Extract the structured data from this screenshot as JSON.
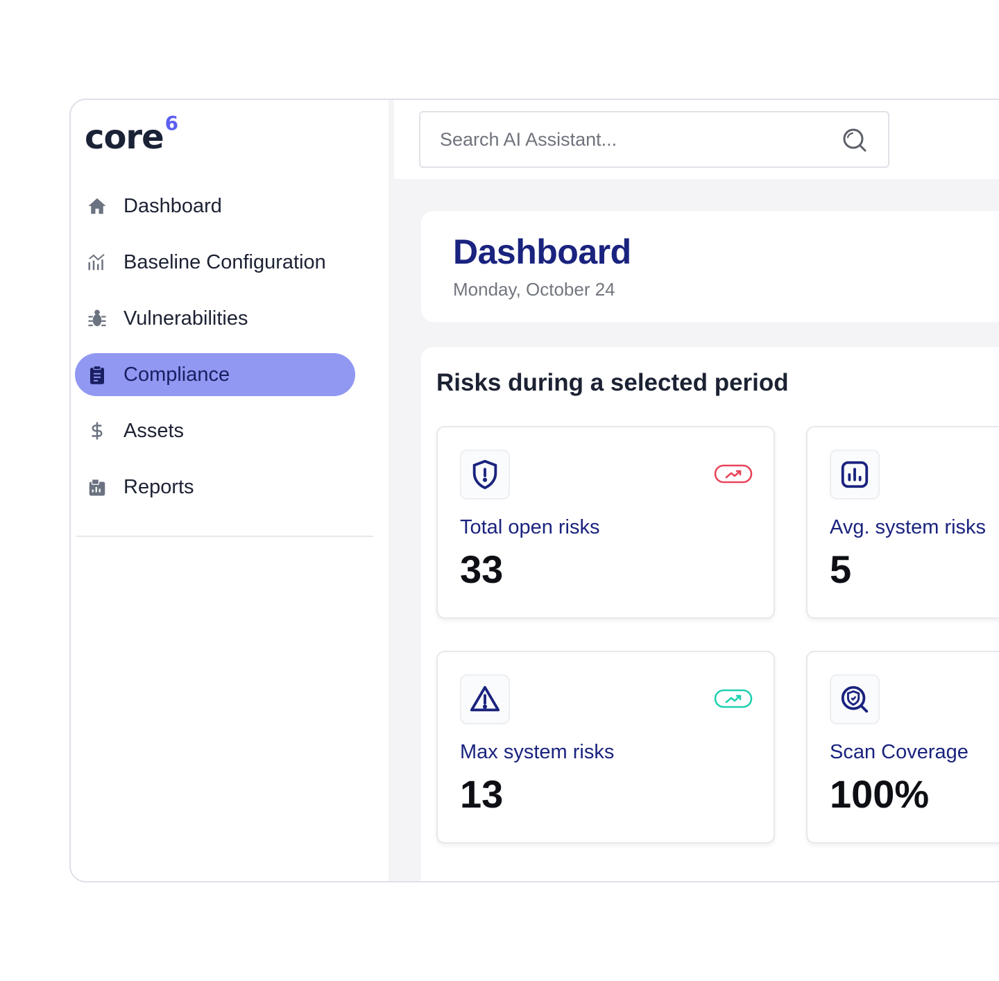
{
  "brand": {
    "name": "core",
    "superscript": "6"
  },
  "sidebar": {
    "items": [
      {
        "label": "Dashboard",
        "icon": "home-icon",
        "active": false
      },
      {
        "label": "Baseline Configuration",
        "icon": "bar-chart-icon",
        "active": false
      },
      {
        "label": "Vulnerabilities",
        "icon": "bug-icon",
        "active": false
      },
      {
        "label": "Compliance",
        "icon": "clipboard-icon",
        "active": true
      },
      {
        "label": "Assets",
        "icon": "dollar-icon",
        "active": false
      },
      {
        "label": "Reports",
        "icon": "report-icon",
        "active": false
      }
    ]
  },
  "search": {
    "placeholder": "Search AI Assistant..."
  },
  "header": {
    "title": "Dashboard",
    "date": "Monday, October 24"
  },
  "risks": {
    "title": "Risks during a selected period",
    "metrics": [
      {
        "label": "Total open risks",
        "value": "33",
        "icon": "shield-alert-icon",
        "trend": "up",
        "trend_color": "#e8445a"
      },
      {
        "label": "Avg. system risks",
        "value": "5",
        "icon": "chart-icon",
        "trend": null
      },
      {
        "label": "Max system risks",
        "value": "13",
        "icon": "warning-icon",
        "trend": "up",
        "trend_color": "#1fd1b0"
      },
      {
        "label": "Scan Coverage",
        "value": "100%",
        "icon": "scan-shield-icon",
        "trend": null
      }
    ]
  },
  "colors": {
    "accent": "#9098f2",
    "primary_text": "#1a237e",
    "brand_superscript": "#5b5ff2"
  }
}
